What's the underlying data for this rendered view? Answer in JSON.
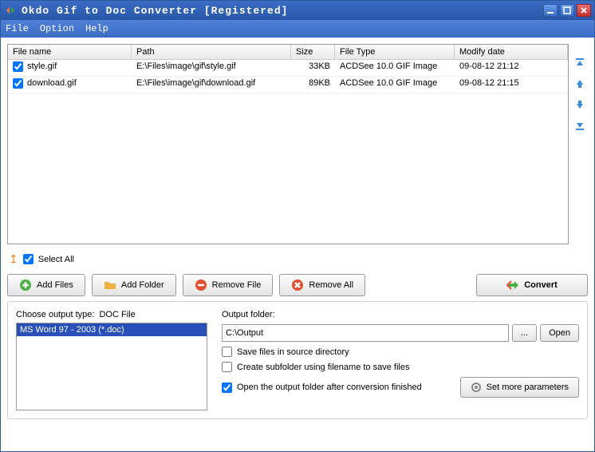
{
  "title": "Okdo Gif to Doc Converter [Registered]",
  "menubar": {
    "file": "File",
    "option": "Option",
    "help": "Help"
  },
  "columns": {
    "name": "File name",
    "path": "Path",
    "size": "Size",
    "type": "File Type",
    "date": "Modify date"
  },
  "files": [
    {
      "checked": true,
      "name": "style.gif",
      "path": "E:\\Files\\image\\gif\\style.gif",
      "size": "33KB",
      "type": "ACDSee 10.0 GIF Image",
      "date": "09-08-12 21:12"
    },
    {
      "checked": true,
      "name": "download.gif",
      "path": "E:\\Files\\image\\gif\\download.gif",
      "size": "89KB",
      "type": "ACDSee 10.0 GIF Image",
      "date": "09-08-12 21:15"
    }
  ],
  "selectall": {
    "label": "Select All",
    "checked": true
  },
  "buttons": {
    "addfiles": "Add Files",
    "addfolder": "Add Folder",
    "removefile": "Remove File",
    "removeall": "Remove All",
    "convert": "Convert"
  },
  "output_type": {
    "label": "Choose output type:",
    "current": "DOC File",
    "items": [
      "MS Word 97 - 2003 (*.doc)"
    ]
  },
  "output_folder": {
    "label": "Output folder:",
    "value": "C:\\Output",
    "browse": "...",
    "open": "Open"
  },
  "options": {
    "save_source": {
      "label": "Save files in source directory",
      "checked": false
    },
    "create_subfolder": {
      "label": "Create subfolder using filename to save files",
      "checked": false
    },
    "open_after": {
      "label": "Open the output folder after conversion finished",
      "checked": true
    }
  },
  "set_more": "Set more parameters"
}
